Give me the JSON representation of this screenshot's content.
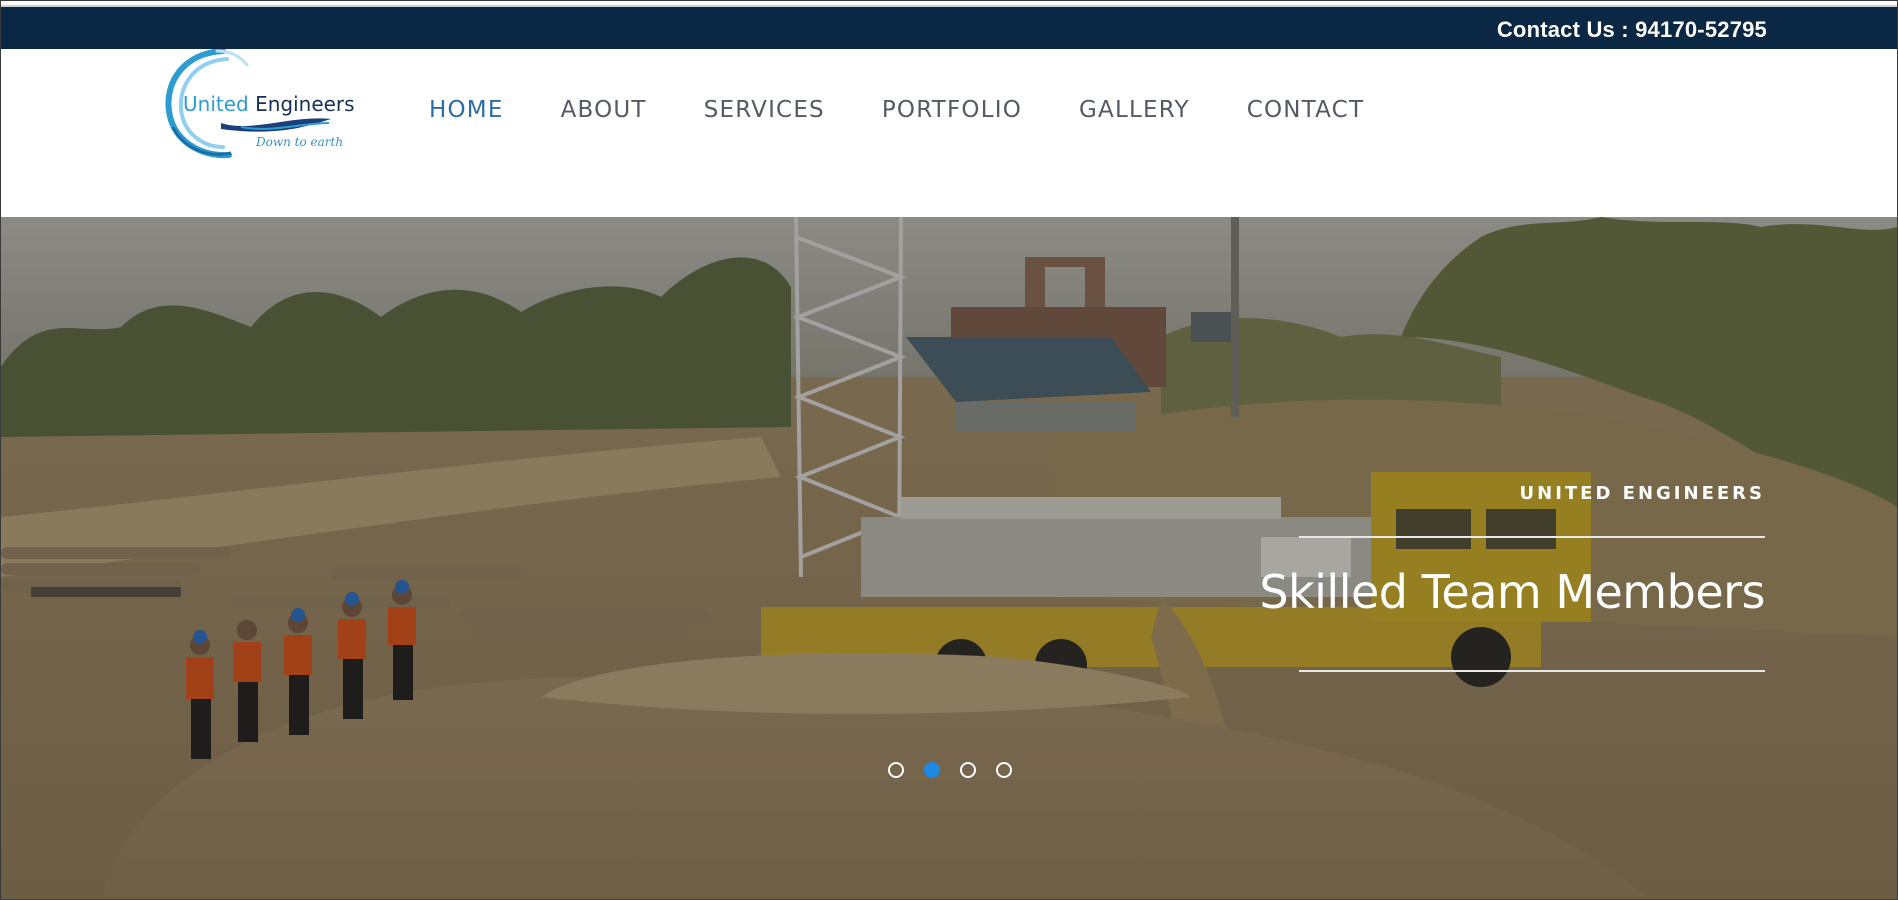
{
  "topbar": {
    "contact_text": "Contact Us : 94170-52795",
    "bg_color": "#0a2744"
  },
  "logo": {
    "name_part1": "United",
    "name_part2": "Engineers",
    "tagline": "Down to earth",
    "accent": "#2e9bd1"
  },
  "nav": {
    "items": [
      {
        "label": "HOME",
        "active": true
      },
      {
        "label": "ABOUT",
        "active": false
      },
      {
        "label": "SERVICES",
        "active": false
      },
      {
        "label": "PORTFOLIO",
        "active": false
      },
      {
        "label": "GALLERY",
        "active": false
      },
      {
        "label": "CONTACT",
        "active": false
      }
    ],
    "active_color": "#2c6ca8"
  },
  "hero": {
    "kicker": "UNITED ENGINEERS",
    "title": "Skilled Team Members",
    "slides": 4,
    "active_slide": 2,
    "dot_active_color": "#1e88e5"
  }
}
